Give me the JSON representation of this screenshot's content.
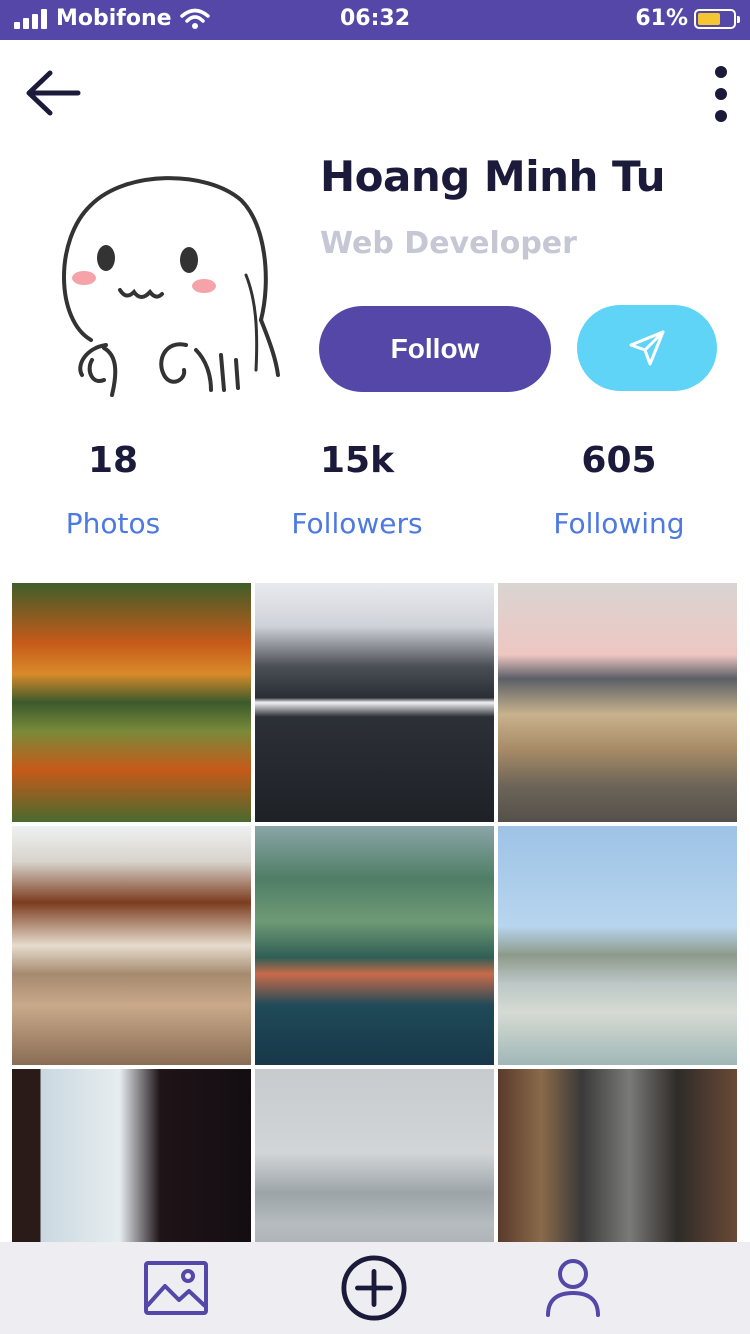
{
  "status": {
    "carrier": "Mobifone",
    "time": "06:32",
    "battery": "61%",
    "battery_level": 0.61
  },
  "nav": {
    "back_icon": "arrow-left-icon",
    "more_icon": "more-vertical-icon"
  },
  "profile": {
    "name": "Hoang Minh Tu",
    "role": "Web Developer",
    "follow_label": "Follow",
    "send_icon": "paper-plane-icon"
  },
  "stats": [
    {
      "value": "18",
      "label": "Photos"
    },
    {
      "value": "15k",
      "label": "Followers"
    },
    {
      "value": "605",
      "label": "Following"
    }
  ],
  "photos": [
    {
      "name": "autumn-forest-reflection"
    },
    {
      "name": "snowy-lake-village"
    },
    {
      "name": "rocks-on-shore"
    },
    {
      "name": "beach-pavilion"
    },
    {
      "name": "aerial-town-lake"
    },
    {
      "name": "outdoor-basketball-court"
    },
    {
      "name": "temple-gate-flag"
    },
    {
      "name": "boat-on-misty-lake"
    },
    {
      "name": "train-street"
    }
  ],
  "colors": {
    "primary": "#5447a7",
    "accent": "#5fd4f6",
    "stat_label": "#4d79e2",
    "muted": "#c6c7d4",
    "dark": "#1b1a3a"
  },
  "tabbar": {
    "items": [
      "image-icon",
      "add-circle-icon",
      "user-icon"
    ]
  }
}
